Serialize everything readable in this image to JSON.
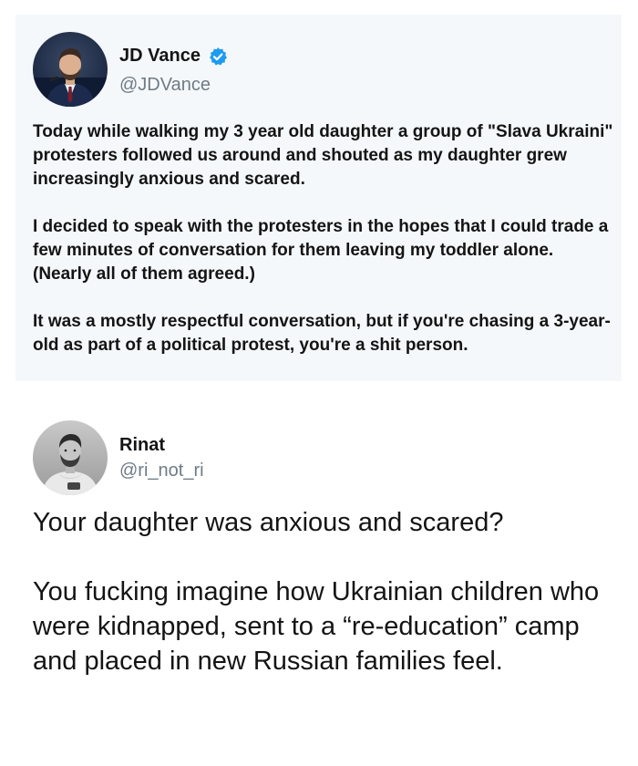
{
  "tweets": [
    {
      "author": {
        "name": "JD Vance",
        "handle": "@JDVance",
        "verified": true,
        "avatar_icon": "portrait-man-in-suit-avatar"
      },
      "body": [
        "Today while walking my 3 year old daughter a group of \"Slava Ukraini\" protesters followed us around and shouted as my daughter grew increasingly anxious and scared.",
        "I decided to speak with the protesters in the hopes that I could trade a few minutes of conversation for them leaving my toddler alone. (Nearly all of them agreed.)",
        "It was a mostly respectful conversation, but if you're chasing a 3-year- old as part of a political protest, you're a shit person."
      ]
    },
    {
      "author": {
        "name": "Rinat",
        "handle": "@ri_not_ri",
        "verified": false,
        "avatar_icon": "portrait-bearded-man-avatar"
      },
      "body": [
        "Your daughter was anxious and scared?",
        "You fucking imagine how Ukrainian children who were kidnapped, sent to a “re-education” camp and placed in new Russian families feel."
      ]
    }
  ],
  "colors": {
    "top_card_background": "#f5f8fa",
    "verified_badge": "#1d9bf0",
    "handle_text": "#6f7b85",
    "body_text": "#141414"
  }
}
